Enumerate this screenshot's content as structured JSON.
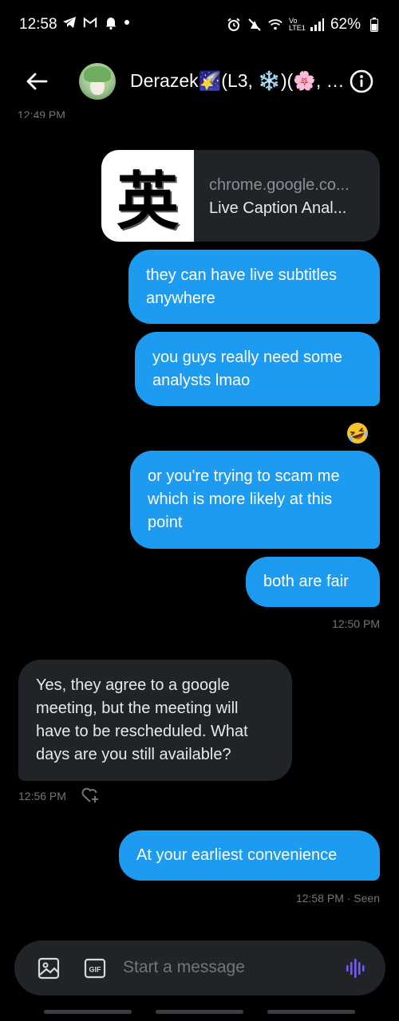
{
  "status_bar": {
    "time": "12:58",
    "battery": "62%",
    "network": "Vo LTE1"
  },
  "header": {
    "title": "Derazek🌠(L3, ❄️)(🌸, …",
    "back_icon": "arrow-left-icon",
    "info_icon": "info-icon"
  },
  "conversation": {
    "top_timestamp": "12:49 PM",
    "link_card": {
      "domain": "chrome.google.co...",
      "title": "Live Caption Anal...",
      "thumbnail_glyph": "英"
    },
    "messages": [
      {
        "side": "out",
        "text": "they can have live subtitles anywhere"
      },
      {
        "side": "out",
        "text": "you guys really need some analysts lmao",
        "reaction": "🤣"
      },
      {
        "side": "out",
        "text": "or you're trying to scam me which is more likely at this point"
      },
      {
        "side": "out",
        "text": "both are fair"
      },
      {
        "side": "in",
        "text": "Yes, they agree to a google meeting, but the meeting will have to be rescheduled. What days are you still available?"
      },
      {
        "side": "out",
        "text": "At your earliest convenience"
      }
    ],
    "meta": {
      "after_both_fair": "12:50 PM",
      "after_incoming": "12:56 PM",
      "after_last": "12:58 PM · Seen"
    }
  },
  "composer": {
    "placeholder": "Start a message",
    "gif_label": "GIF"
  },
  "colors": {
    "outgoing_bubble": "#1d9bf0",
    "incoming_bubble": "#202327",
    "background": "#000000",
    "muted_text": "#71767b",
    "voice_accent": "#7856ff"
  }
}
